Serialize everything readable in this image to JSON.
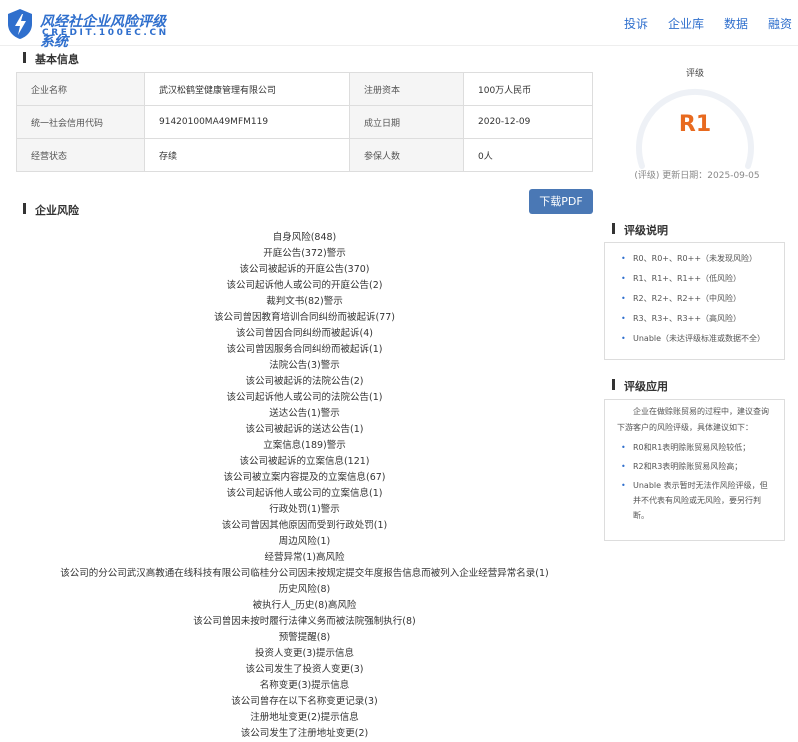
{
  "header": {
    "logo_title": "风经社企业风险评级系统",
    "logo_sub": "CREDIT.100EC.CN",
    "nav": [
      "投诉",
      "企业库",
      "数据",
      "融资"
    ]
  },
  "basic": {
    "title": "基本信息",
    "rows": [
      {
        "k1": "企业名称",
        "v1": "武汉松鹤堂健康管理有限公司",
        "k2": "注册资本",
        "v2": "100万人民币"
      },
      {
        "k1": "统一社会信用代码",
        "v1": "91420100MA49MFM119",
        "k2": "成立日期",
        "v2": "2020-12-09"
      },
      {
        "k1": "经营状态",
        "v1": "存续",
        "k2": "参保人数",
        "v2": "0人"
      }
    ]
  },
  "risk": {
    "title": "企业风险",
    "pdf_button": "下载PDF",
    "items": [
      "自身风险(848)",
      "开庭公告(372)警示",
      "该公司被起诉的开庭公告(370)",
      "该公司起诉他人或公司的开庭公告(2)",
      "裁判文书(82)警示",
      "该公司曾因教育培训合同纠纷而被起诉(77)",
      "该公司曾因合同纠纷而被起诉(4)",
      "该公司曾因服务合同纠纷而被起诉(1)",
      "法院公告(3)警示",
      "该公司被起诉的法院公告(2)",
      "该公司起诉他人或公司的法院公告(1)",
      "送达公告(1)警示",
      "该公司被起诉的送达公告(1)",
      "立案信息(189)警示",
      "该公司被起诉的立案信息(121)",
      "该公司被立案内容提及的立案信息(67)",
      "该公司起诉他人或公司的立案信息(1)",
      "行政处罚(1)警示",
      "该公司曾因其他原因而受到行政处罚(1)",
      "周边风险(1)",
      "经营异常(1)高风险",
      "该公司的分公司武汉高教通在线科技有限公司临桂分公司因未按规定提交年度报告信息而被列入企业经营异常名录(1)",
      "历史风险(8)",
      "被执行人_历史(8)高风险",
      "该公司曾因未按时履行法律义务而被法院强制执行(8)",
      "预警提醒(8)",
      "投资人变更(3)提示信息",
      "该公司发生了投资人变更(3)",
      "名称变更(3)提示信息",
      "该公司曾存在以下名称变更记录(3)",
      "注册地址变更(2)提示信息",
      "该公司发生了注册地址变更(2)"
    ]
  },
  "rating": {
    "label": "评级",
    "value": "R1",
    "date": "(评级) 更新日期：2025-09-05",
    "accent": "#e86a1f"
  },
  "explain": {
    "title": "评级说明",
    "items": [
      "R0、R0+、R0++（未发现风险）",
      "R1、R1+、R1++（低风险）",
      "R2、R2+、R2++（中风险）",
      "R3、R3+、R3++（高风险）",
      "Unable（未达评级标准或数据不全）"
    ]
  },
  "apply": {
    "title": "评级应用",
    "intro": "企业在做赊账贸易的过程中，建议查询下游客户的风险评级，具体建议如下：",
    "items": [
      "R0和R1表明赊账贸易风险较低；",
      "R2和R3表明赊账贸易风险高；",
      "Unable 表示暂时无法作风险评级，但并不代表有风险或无风险，要另行判断。"
    ]
  }
}
